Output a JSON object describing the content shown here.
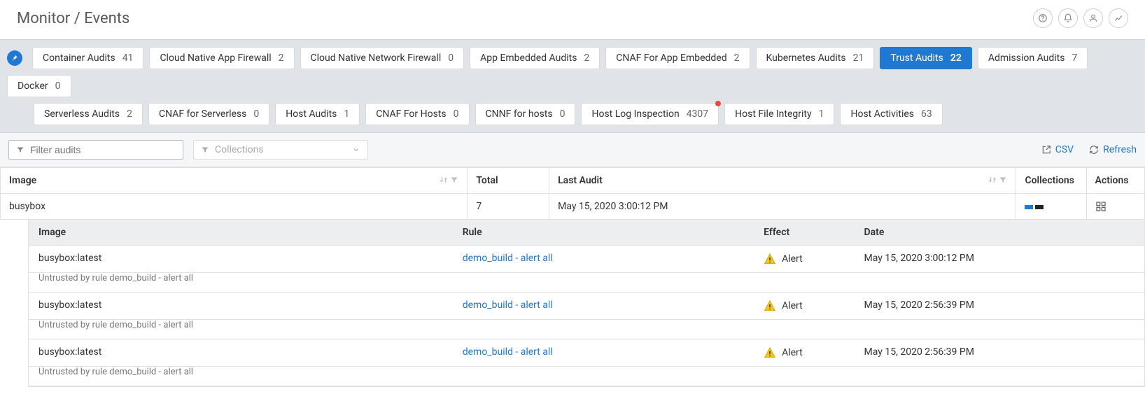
{
  "header": {
    "title": "Monitor / Events"
  },
  "tabs": {
    "row1": [
      {
        "label": "Container Audits",
        "count": "41"
      },
      {
        "label": "Cloud Native App Firewall",
        "count": "2"
      },
      {
        "label": "Cloud Native Network Firewall",
        "count": "0"
      },
      {
        "label": "App Embedded Audits",
        "count": "2"
      },
      {
        "label": "CNAF For App Embedded",
        "count": "2"
      },
      {
        "label": "Kubernetes Audits",
        "count": "21"
      },
      {
        "label": "Trust Audits",
        "count": "22",
        "active": true
      },
      {
        "label": "Admission Audits",
        "count": "7"
      },
      {
        "label": "Docker",
        "count": "0"
      }
    ],
    "row2": [
      {
        "label": "Serverless Audits",
        "count": "2"
      },
      {
        "label": "CNAF for Serverless",
        "count": "0"
      },
      {
        "label": "Host Audits",
        "count": "1"
      },
      {
        "label": "CNAF For Hosts",
        "count": "0"
      },
      {
        "label": "CNNF for hosts",
        "count": "0"
      },
      {
        "label": "Host Log Inspection",
        "count": "4307",
        "indicator": true
      },
      {
        "label": "Host File Integrity",
        "count": "1"
      },
      {
        "label": "Host Activities",
        "count": "63"
      }
    ]
  },
  "toolbar": {
    "filter_placeholder": "Filter audits",
    "collections_placeholder": "Collections",
    "csv_label": "CSV",
    "refresh_label": "Refresh"
  },
  "table": {
    "headers": {
      "image": "Image",
      "total": "Total",
      "last_audit": "Last Audit",
      "collections": "Collections",
      "actions": "Actions"
    },
    "row": {
      "image": "busybox",
      "total": "7",
      "last_audit": "May 15, 2020 3:00:12 PM",
      "collection_colors": [
        "#1f78d1",
        "#222"
      ]
    }
  },
  "detail": {
    "headers": {
      "image": "Image",
      "rule": "Rule",
      "effect": "Effect",
      "date": "Date"
    },
    "rows": [
      {
        "image": "busybox:latest",
        "rule": "demo_build - alert all",
        "effect": "Alert",
        "date": "May 15, 2020 3:00:12 PM",
        "sub": "Untrusted by rule demo_build - alert all"
      },
      {
        "image": "busybox:latest",
        "rule": "demo_build - alert all",
        "effect": "Alert",
        "date": "May 15, 2020 2:56:39 PM",
        "sub": "Untrusted by rule demo_build - alert all"
      },
      {
        "image": "busybox:latest",
        "rule": "demo_build - alert all",
        "effect": "Alert",
        "date": "May 15, 2020 2:56:39 PM",
        "sub": "Untrusted by rule demo_build - alert all"
      }
    ]
  }
}
